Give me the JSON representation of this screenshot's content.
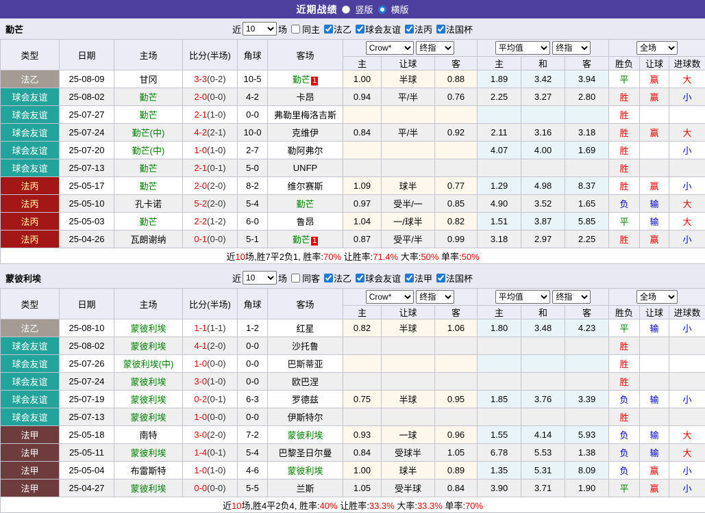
{
  "top_bar": {
    "title": "近期战绩",
    "radios": [
      {
        "label": "竖版",
        "selected": false
      },
      {
        "label": "横版",
        "selected": true
      }
    ],
    "bg": "#4c3f9e"
  },
  "colors": {
    "league": {
      "法乙": {
        "bg": "#a39b94",
        "fg": "#ffffff"
      },
      "球会友谊": {
        "bg": "#22a39b",
        "fg": "#ffffff"
      },
      "法丙": {
        "bg": "#a31717",
        "fg": "#ffffaa"
      },
      "法甲": {
        "bg": "#6e3c3c",
        "fg": "#ffffff"
      }
    },
    "result": {
      "胜": "#e60000",
      "平": "#008000",
      "负": "#0000cc",
      "赢": "#e60000",
      "输": "#0000cc",
      "大": "#e60000",
      "小": "#0000cc"
    },
    "focus_team": "#008000",
    "score_main": "#e60000",
    "badge_bg": "#e60000"
  },
  "table_headers": {
    "type": "类型",
    "date": "日期",
    "home": "主场",
    "score": "比分(半场)",
    "corner": "角球",
    "away": "客场",
    "odds_cols": [
      "主",
      "让球",
      "客"
    ],
    "avg_cols": [
      "主",
      "和",
      "客"
    ],
    "result_cols": [
      "胜负",
      "让球",
      "进球数"
    ]
  },
  "sections": [
    {
      "team": "勤芒",
      "filter": {
        "near_label": "近",
        "count": "10",
        "games_label": "场",
        "same_label": "同主",
        "same_checked": false,
        "leagues": [
          {
            "label": "法乙",
            "checked": true
          },
          {
            "label": "球会友谊",
            "checked": true
          },
          {
            "label": "法丙",
            "checked": true
          },
          {
            "label": "法国杯",
            "checked": true
          }
        ]
      },
      "selects": {
        "odds_source": "Crow*",
        "odds_kind": "终指",
        "avg": "平均值",
        "avg_kind": "终指",
        "scope": "全场"
      },
      "rows": [
        {
          "type": "法乙",
          "date": "25-08-09",
          "home": "甘冈",
          "home_focus": false,
          "score": "3-3",
          "half": "(0-2)",
          "corner": "10-5",
          "away": "勤芒",
          "away_focus": true,
          "away_badge": "1",
          "odds": [
            "1.00",
            "半球",
            "0.88"
          ],
          "avg": [
            "1.89",
            "3.42",
            "3.94"
          ],
          "res": [
            "平",
            "赢",
            "大"
          ]
        },
        {
          "type": "球会友谊",
          "date": "25-08-02",
          "home": "勤芒",
          "home_focus": true,
          "score": "2-0",
          "half": "(0-0)",
          "corner": "4-2",
          "away": "卡昂",
          "away_focus": false,
          "odds": [
            "0.94",
            "平/半",
            "0.76"
          ],
          "avg": [
            "2.25",
            "3.27",
            "2.80"
          ],
          "res": [
            "胜",
            "赢",
            "小"
          ]
        },
        {
          "type": "球会友谊",
          "date": "25-07-27",
          "home": "勤芒",
          "home_focus": true,
          "score": "2-1",
          "half": "(1-0)",
          "corner": "0-0",
          "away": "弗勒里梅洛吉斯",
          "away_focus": false,
          "odds": [
            "",
            "",
            ""
          ],
          "avg": [
            "",
            "",
            ""
          ],
          "res": [
            "胜",
            "",
            ""
          ]
        },
        {
          "type": "球会友谊",
          "date": "25-07-24",
          "home": "勤芒(中)",
          "home_focus": true,
          "score": "4-2",
          "half": "(2-1)",
          "corner": "10-0",
          "away": "克维伊",
          "away_focus": false,
          "odds": [
            "0.84",
            "平/半",
            "0.92"
          ],
          "avg": [
            "2.11",
            "3.16",
            "3.18"
          ],
          "res": [
            "胜",
            "赢",
            "大"
          ]
        },
        {
          "type": "球会友谊",
          "date": "25-07-20",
          "home": "勤芒(中)",
          "home_focus": true,
          "score": "1-0",
          "half": "(1-0)",
          "corner": "2-7",
          "away": "勒阿弗尔",
          "away_focus": false,
          "odds": [
            "",
            "",
            ""
          ],
          "avg": [
            "4.07",
            "4.00",
            "1.69"
          ],
          "res": [
            "胜",
            "",
            "小"
          ]
        },
        {
          "type": "球会友谊",
          "date": "25-07-13",
          "home": "勤芒",
          "home_focus": true,
          "score": "2-1",
          "half": "(0-1)",
          "corner": "5-0",
          "away": "UNFP",
          "away_focus": false,
          "odds": [
            "",
            "",
            ""
          ],
          "avg": [
            "",
            "",
            ""
          ],
          "res": [
            "胜",
            "",
            ""
          ]
        },
        {
          "type": "法丙",
          "date": "25-05-17",
          "home": "勤芒",
          "home_focus": true,
          "score": "2-0",
          "half": "(2-0)",
          "corner": "8-2",
          "away": "维尔赛斯",
          "away_focus": false,
          "odds": [
            "1.09",
            "球半",
            "0.77"
          ],
          "avg": [
            "1.29",
            "4.98",
            "8.37"
          ],
          "res": [
            "胜",
            "赢",
            "小"
          ]
        },
        {
          "type": "法丙",
          "date": "25-05-10",
          "home": "孔卡诺",
          "home_focus": false,
          "score": "5-2",
          "half": "(2-0)",
          "corner": "5-4",
          "away": "勤芒",
          "away_focus": true,
          "odds": [
            "0.97",
            "受半/一",
            "0.85"
          ],
          "avg": [
            "4.90",
            "3.52",
            "1.65"
          ],
          "res": [
            "负",
            "输",
            "大"
          ]
        },
        {
          "type": "法丙",
          "date": "25-05-03",
          "home": "勤芒",
          "home_focus": true,
          "score": "2-2",
          "half": "(1-2)",
          "corner": "6-0",
          "away": "鲁昂",
          "away_focus": false,
          "odds": [
            "1.04",
            "一/球半",
            "0.82"
          ],
          "avg": [
            "1.51",
            "3.87",
            "5.85"
          ],
          "res": [
            "平",
            "输",
            "大"
          ]
        },
        {
          "type": "法丙",
          "date": "25-04-26",
          "home": "瓦朗谢纳",
          "home_focus": false,
          "score": "0-1",
          "half": "(0-0)",
          "corner": "5-1",
          "away": "勤芒",
          "away_focus": true,
          "away_badge": "1",
          "odds": [
            "0.87",
            "受平/半",
            "0.99"
          ],
          "avg": [
            "3.18",
            "2.97",
            "2.25"
          ],
          "res": [
            "胜",
            "赢",
            "小"
          ]
        }
      ],
      "summary": [
        {
          "t": "近",
          "c": "k"
        },
        {
          "t": "10",
          "c": "r"
        },
        {
          "t": "场,胜7平2负1, 胜率:",
          "c": "k"
        },
        {
          "t": "70%",
          "c": "r"
        },
        {
          "t": " 让胜率:",
          "c": "k"
        },
        {
          "t": "71.4%",
          "c": "r"
        },
        {
          "t": " 大率:",
          "c": "k"
        },
        {
          "t": "50%",
          "c": "r"
        },
        {
          "t": " 单率:",
          "c": "k"
        },
        {
          "t": "50%",
          "c": "r"
        }
      ]
    },
    {
      "team": "蒙彼利埃",
      "filter": {
        "near_label": "近",
        "count": "10",
        "games_label": "场",
        "same_label": "同客",
        "same_checked": false,
        "leagues": [
          {
            "label": "法乙",
            "checked": true
          },
          {
            "label": "球会友谊",
            "checked": true
          },
          {
            "label": "法甲",
            "checked": true
          },
          {
            "label": "法国杯",
            "checked": true
          }
        ]
      },
      "selects": {
        "odds_source": "Crow*",
        "odds_kind": "终指",
        "avg": "平均值",
        "avg_kind": "终指",
        "scope": "全场"
      },
      "rows": [
        {
          "type": "法乙",
          "date": "25-08-10",
          "home": "蒙彼利埃",
          "home_focus": true,
          "score": "1-1",
          "half": "(1-1)",
          "corner": "1-2",
          "away": "红星",
          "away_focus": false,
          "odds": [
            "0.82",
            "半球",
            "1.06"
          ],
          "avg": [
            "1.80",
            "3.48",
            "4.23"
          ],
          "res": [
            "平",
            "输",
            "小"
          ]
        },
        {
          "type": "球会友谊",
          "date": "25-08-02",
          "home": "蒙彼利埃",
          "home_focus": true,
          "score": "4-1",
          "half": "(2-0)",
          "corner": "0-0",
          "away": "沙托鲁",
          "away_focus": false,
          "odds": [
            "",
            "",
            ""
          ],
          "avg": [
            "",
            "",
            ""
          ],
          "res": [
            "胜",
            "",
            ""
          ]
        },
        {
          "type": "球会友谊",
          "date": "25-07-26",
          "home": "蒙彼利埃(中)",
          "home_focus": true,
          "score": "1-0",
          "half": "(0-0)",
          "corner": "0-0",
          "away": "巴斯蒂亚",
          "away_focus": false,
          "odds": [
            "",
            "",
            ""
          ],
          "avg": [
            "",
            "",
            ""
          ],
          "res": [
            "胜",
            "",
            ""
          ]
        },
        {
          "type": "球会友谊",
          "date": "25-07-24",
          "home": "蒙彼利埃",
          "home_focus": true,
          "score": "3-0",
          "half": "(1-0)",
          "corner": "0-0",
          "away": "欧巴涅",
          "away_focus": false,
          "odds": [
            "",
            "",
            ""
          ],
          "avg": [
            "",
            "",
            ""
          ],
          "res": [
            "胜",
            "",
            ""
          ]
        },
        {
          "type": "球会友谊",
          "date": "25-07-19",
          "home": "蒙彼利埃",
          "home_focus": true,
          "score": "0-2",
          "half": "(0-1)",
          "corner": "6-3",
          "away": "罗德兹",
          "away_focus": false,
          "odds": [
            "0.75",
            "半球",
            "0.95"
          ],
          "avg": [
            "1.85",
            "3.76",
            "3.39"
          ],
          "res": [
            "负",
            "输",
            "小"
          ]
        },
        {
          "type": "球会友谊",
          "date": "25-07-13",
          "home": "蒙彼利埃",
          "home_focus": true,
          "score": "1-0",
          "half": "(0-0)",
          "corner": "0-0",
          "away": "伊斯特尔",
          "away_focus": false,
          "odds": [
            "",
            "",
            ""
          ],
          "avg": [
            "",
            "",
            ""
          ],
          "res": [
            "胜",
            "",
            ""
          ]
        },
        {
          "type": "法甲",
          "date": "25-05-18",
          "home": "南特",
          "home_focus": false,
          "score": "3-0",
          "half": "(2-0)",
          "corner": "7-2",
          "away": "蒙彼利埃",
          "away_focus": true,
          "odds": [
            "0.93",
            "一球",
            "0.96"
          ],
          "avg": [
            "1.55",
            "4.14",
            "5.93"
          ],
          "res": [
            "负",
            "输",
            "大"
          ]
        },
        {
          "type": "法甲",
          "date": "25-05-11",
          "home": "蒙彼利埃",
          "home_focus": true,
          "score": "1-4",
          "half": "(0-1)",
          "corner": "5-4",
          "away": "巴黎圣日尔曼",
          "away_focus": false,
          "odds": [
            "0.84",
            "受球半",
            "1.05"
          ],
          "avg": [
            "6.78",
            "5.53",
            "1.38"
          ],
          "res": [
            "负",
            "输",
            "大"
          ]
        },
        {
          "type": "法甲",
          "date": "25-05-04",
          "home": "布雷斯特",
          "home_focus": false,
          "score": "1-0",
          "half": "(1-0)",
          "corner": "4-6",
          "away": "蒙彼利埃",
          "away_focus": true,
          "odds": [
            "1.00",
            "球半",
            "0.89"
          ],
          "avg": [
            "1.35",
            "5.31",
            "8.09"
          ],
          "res": [
            "负",
            "赢",
            "小"
          ]
        },
        {
          "type": "法甲",
          "date": "25-04-27",
          "home": "蒙彼利埃",
          "home_focus": true,
          "score": "0-0",
          "half": "(0-0)",
          "corner": "5-5",
          "away": "兰斯",
          "away_focus": false,
          "odds": [
            "1.05",
            "受半球",
            "0.84"
          ],
          "avg": [
            "3.90",
            "3.71",
            "1.90"
          ],
          "res": [
            "平",
            "赢",
            "小"
          ]
        }
      ],
      "summary": [
        {
          "t": "近",
          "c": "k"
        },
        {
          "t": "10",
          "c": "r"
        },
        {
          "t": "场,胜4平2负4, 胜率:",
          "c": "k"
        },
        {
          "t": "40%",
          "c": "r"
        },
        {
          "t": " 让胜率:",
          "c": "k"
        },
        {
          "t": "33.3%",
          "c": "r"
        },
        {
          "t": " 大率:",
          "c": "k"
        },
        {
          "t": "33.3%",
          "c": "r"
        },
        {
          "t": " 单率:",
          "c": "k"
        },
        {
          "t": "70%",
          "c": "r"
        }
      ]
    }
  ]
}
